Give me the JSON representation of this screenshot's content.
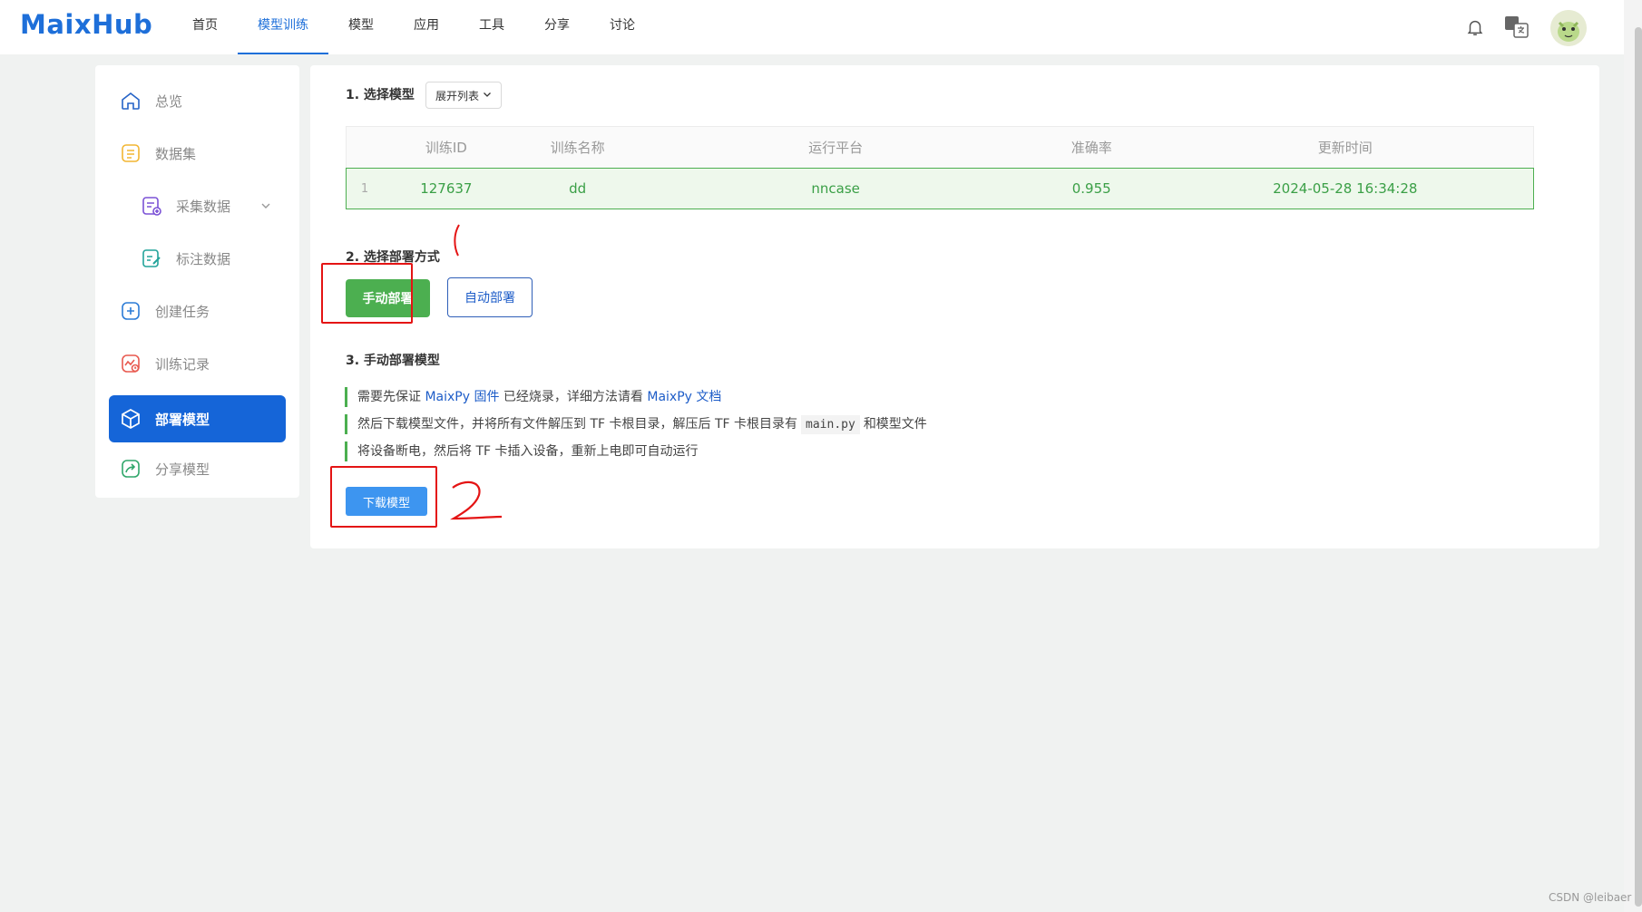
{
  "header": {
    "logo": "MaixHub",
    "nav": [
      "首页",
      "模型训练",
      "模型",
      "应用",
      "工具",
      "分享",
      "讨论"
    ],
    "active_nav": "模型训练"
  },
  "sidebar": {
    "items": [
      {
        "label": "总览",
        "icon": "home-icon"
      },
      {
        "label": "数据集",
        "icon": "dataset-icon"
      },
      {
        "label": "采集数据",
        "icon": "collect-icon"
      },
      {
        "label": "标注数据",
        "icon": "annotate-icon"
      },
      {
        "label": "创建任务",
        "icon": "plus-icon"
      },
      {
        "label": "训练记录",
        "icon": "record-icon"
      },
      {
        "label": "部署模型",
        "icon": "cube-icon"
      },
      {
        "label": "分享模型",
        "icon": "share-icon"
      }
    ],
    "active": "部署模型"
  },
  "main": {
    "step1_title": "1. 选择模型",
    "expand_list": "展开列表",
    "table": {
      "columns": [
        "训练ID",
        "训练名称",
        "运行平台",
        "准确率",
        "更新时间"
      ],
      "rows": [
        {
          "index": "1",
          "id": "127637",
          "name": "dd",
          "platform": "nncase",
          "accuracy": "0.955",
          "updated": "2024-05-28 16:34:28"
        }
      ]
    },
    "step2_title": "2. 选择部署方式",
    "manual_deploy": "手动部署",
    "auto_deploy": "自动部署",
    "step3_title": "3. 手动部署模型",
    "instructions": {
      "line1_pre": "需要先保证 ",
      "line1_link1": "MaixPy 固件",
      "line1_mid": " 已经烧录，详细方法请看 ",
      "line1_link2": "MaixPy 文档",
      "line2_pre": "然后下载模型文件，并将所有文件解压到 TF 卡根目录，解压后 TF 卡根目录有",
      "line2_code": "main.py",
      "line2_post": "和模型文件",
      "line3": "将设备断电，然后将 TF 卡插入设备，重新上电即可自动运行"
    },
    "download_button": "下载模型"
  },
  "watermark": "CSDN @leibaer",
  "colors": {
    "primary": "#1565d8",
    "green": "#4caf50",
    "annotation_red": "#e41414"
  }
}
